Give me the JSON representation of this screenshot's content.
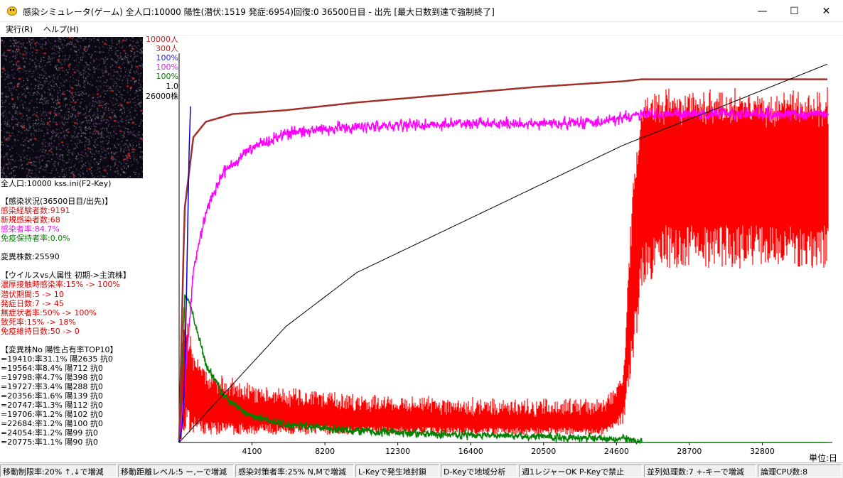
{
  "window": {
    "title": "感染シミュレータ(ゲーム) 全人口:10000 陽性(潜伏:1519 発症:6954)回復:0 36500日目 - 出先 [最大日数到達で強制終了]",
    "minimize_glyph": "—",
    "maximize_glyph": "☐",
    "close_glyph": "✕",
    "icon": "app-face-icon"
  },
  "menu": {
    "items": [
      {
        "label": "実行(R)"
      },
      {
        "label": "ヘルプ(H)"
      }
    ]
  },
  "panel": {
    "population_line": "全人口:10000  kss.ini(F2-Key)",
    "lines": [
      {
        "text": "【感染状況(36500日目/出先)】",
        "color": "#000000"
      },
      {
        "text": "感染経験者数:9191",
        "color": "#c02020"
      },
      {
        "text": "新規感染者数:68",
        "color": "#e00000"
      },
      {
        "text": "感染者率:84.7%",
        "color": "#e020e0"
      },
      {
        "text": "免疫保持者率:0.0%",
        "color": "#008000"
      },
      {
        "text": "",
        "color": "#000000"
      },
      {
        "text": "変異株数:25590",
        "color": "#000000"
      },
      {
        "text": "",
        "color": "#000000"
      },
      {
        "text": "【ウイルスvs人属性 初期->主流株】",
        "color": "#000000"
      },
      {
        "text": "濃厚接触時感染率:15% -> 100%",
        "color": "#e00000"
      },
      {
        "text": "潜伏期間:5 -> 10",
        "color": "#e00000"
      },
      {
        "text": "発症日数:7 -> 45",
        "color": "#e00000"
      },
      {
        "text": "無症状者率:50% -> 100%",
        "color": "#e00000"
      },
      {
        "text": "致死率:15% -> 18%",
        "color": "#e00000"
      },
      {
        "text": "免疫維持日数:50 -> 0",
        "color": "#e00000"
      },
      {
        "text": "",
        "color": "#000000"
      },
      {
        "text": "【変異株No 陽性占有率TOP10】",
        "color": "#000000"
      },
      {
        "text": "=19410:率31.1% 陽2635 抗0",
        "color": "#000000"
      },
      {
        "text": "=19564:率8.4% 陽712 抗0",
        "color": "#000000"
      },
      {
        "text": "=19798:率4.7% 陽398 抗0",
        "color": "#000000"
      },
      {
        "text": "=19727:率3.4% 陽288 抗0",
        "color": "#000000"
      },
      {
        "text": "=20356:率1.6% 陽139 抗0",
        "color": "#000000"
      },
      {
        "text": "=20747:率1.3% 陽112 抗0",
        "color": "#000000"
      },
      {
        "text": "=19706:率1.2% 陽102 抗0",
        "color": "#000000"
      },
      {
        "text": "=22684:率1.2% 陽100 抗0",
        "color": "#000000"
      },
      {
        "text": "=24054:率1.2% 陽99 抗0",
        "color": "#000000"
      },
      {
        "text": "=20775:率1.1% 陽90 抗0",
        "color": "#000000"
      }
    ]
  },
  "chart_data": {
    "type": "line",
    "axis_labels_left": [
      {
        "text": "10000人",
        "color": "#c02020"
      },
      {
        "text": "300人",
        "color": "#c02020"
      },
      {
        "text": "100%",
        "color": "#2020e0"
      },
      {
        "text": "100%",
        "color": "#e020e0"
      },
      {
        "text": "100%",
        "color": "#008000"
      },
      {
        "text": "1.0",
        "color": "#000000"
      },
      {
        "text": "26000株",
        "color": "#000000"
      }
    ],
    "x_ticks": [
      "4100",
      "8200",
      "12300",
      "16400",
      "20500",
      "24600",
      "28700",
      "32800"
    ],
    "x_tick_values": [
      4100,
      8200,
      12300,
      16400,
      20500,
      24600,
      28700,
      32800
    ],
    "xlim": [
      0,
      36500
    ],
    "unit_label": "単位:日",
    "series": [
      {
        "key": "experienced",
        "color": "#a0302a",
        "x": [
          0,
          300,
          800,
          1500,
          3000,
          6000,
          10000,
          15000,
          20000,
          25000,
          26000,
          30000,
          36500
        ],
        "y": [
          0,
          0.6,
          0.79,
          0.83,
          0.85,
          0.86,
          0.88,
          0.9,
          0.92,
          0.935,
          0.94,
          0.94,
          0.94
        ]
      },
      {
        "key": "infected_rate",
        "color": "#ff00ff",
        "noise": 0.008,
        "x": [
          0,
          300,
          800,
          1500,
          2500,
          4000,
          6000,
          9000,
          12000,
          16000,
          20000,
          24000,
          26000,
          27000,
          36500
        ],
        "y": [
          0,
          0.15,
          0.45,
          0.6,
          0.7,
          0.76,
          0.8,
          0.815,
          0.82,
          0.825,
          0.825,
          0.83,
          0.85,
          0.85,
          0.85
        ]
      },
      {
        "key": "immune_rate",
        "color": "#008000",
        "noise": 0.006,
        "x": [
          0,
          300,
          600,
          1500,
          2500,
          4000,
          6000,
          10000,
          15000,
          20000,
          25000,
          26000,
          27000,
          36500
        ],
        "y": [
          0,
          0.38,
          0.36,
          0.2,
          0.12,
          0.07,
          0.045,
          0.03,
          0.02,
          0.015,
          0.01,
          0.0,
          0.0,
          0.0
        ]
      },
      {
        "key": "infected_flu",
        "color": "#0000e0",
        "x": [
          0,
          100,
          200,
          300,
          400,
          500,
          600,
          700
        ],
        "y": [
          0,
          0.02,
          0.05,
          0.15,
          0.35,
          0.6,
          0.85,
          0.9
        ]
      },
      {
        "key": "new_infected",
        "color": "#ff0000",
        "noise": 0.04,
        "band": true,
        "x": [
          0,
          300,
          800,
          2000,
          5000,
          10000,
          15000,
          20000,
          24000,
          25000,
          25500,
          26000,
          27000,
          30000,
          36500
        ],
        "y_low": [
          0,
          0.02,
          0.02,
          0.02,
          0.02,
          0.02,
          0.02,
          0.02,
          0.02,
          0.05,
          0.18,
          0.38,
          0.45,
          0.45,
          0.45
        ],
        "y_high": [
          0,
          0.35,
          0.22,
          0.16,
          0.13,
          0.11,
          0.1,
          0.095,
          0.1,
          0.18,
          0.65,
          0.88,
          0.9,
          0.9,
          0.9
        ]
      },
      {
        "key": "variants",
        "color": "#000000",
        "x": [
          0,
          2000,
          6000,
          10000,
          15000,
          20000,
          25000,
          30000,
          36500
        ],
        "y": [
          0,
          0.1,
          0.3,
          0.44,
          0.55,
          0.66,
          0.77,
          0.86,
          0.98
        ]
      }
    ]
  },
  "status": {
    "cells": [
      "移動制限率:20% ↑,↓で増減",
      "移動距離レベル:5 ー,ーで増減",
      "感染対策者率:25% N,Mで増減",
      "L-Keyで発生地封鎖",
      "D-Keyで地域分析",
      "週1レジャーOK P-Keyで禁止",
      "並列処理数:7 +-キーで増減",
      "論理CPU数:8"
    ]
  }
}
